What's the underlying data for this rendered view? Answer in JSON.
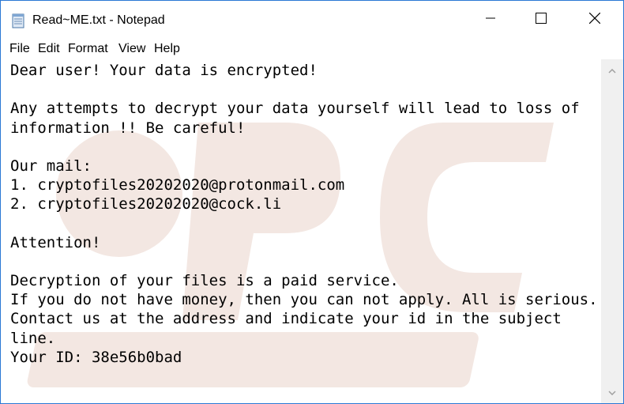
{
  "window": {
    "title": "Read~ME.txt - Notepad",
    "app_icon": "notepad-icon",
    "controls": {
      "minimize_icon": "minimize-icon",
      "maximize_icon": "maximize-icon",
      "close_icon": "close-icon"
    }
  },
  "menu": {
    "items": [
      {
        "label": "File"
      },
      {
        "label": "Edit"
      },
      {
        "label": "Format"
      },
      {
        "label": "View"
      },
      {
        "label": "Help"
      }
    ]
  },
  "document": {
    "lines": [
      "Dear user! Your data is encrypted!",
      "",
      "Any attempts to decrypt your data yourself will lead to loss of",
      "information !! Be careful!",
      "",
      "Our mail:",
      "1. cryptofiles20202020@protonmail.com",
      "2. cryptofiles20202020@cock.li",
      "",
      "Attention!",
      "",
      "Decryption of your files is a paid service.",
      "If you do not have money, then you can not apply. All is serious.",
      "Contact us at the address and indicate your id in the subject",
      "line.",
      "Your ID: 38e56b0bad"
    ]
  },
  "scrollbar": {
    "up_icon": "scroll-up-arrow-icon",
    "down_icon": "scroll-down-arrow-icon"
  },
  "colors": {
    "window_border": "#2b78d4",
    "scrollbar_bg": "#f0f0f0",
    "scroll_arrow": "#a0a0a0",
    "watermark": "#f3e7e2"
  }
}
